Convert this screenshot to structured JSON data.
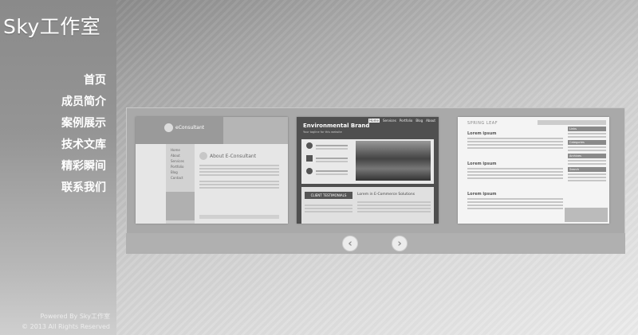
{
  "logo": "Sky工作室",
  "nav": [
    "首页",
    "成员简介",
    "案例展示",
    "技术文库",
    "精彩瞬间",
    "联系我们"
  ],
  "footer": {
    "line1": "Powered By Sky工作室",
    "line2": "© 2013 All Rights Reserved"
  },
  "slider": {
    "prev_icon": "chevron-left-icon",
    "next_icon": "chevron-right-icon",
    "prev_glyph": "‹",
    "next_glyph": "›",
    "thumbs": [
      {
        "logo_text": "eConsultant",
        "heading": "About E-Consultant",
        "menu": [
          "Home",
          "About",
          "Services",
          "Portfolio",
          "Blog",
          "Contact"
        ]
      },
      {
        "title": "Environmental Brand",
        "subtitle": "Your tagline for this website",
        "tabs": [
          "Home",
          "Services",
          "Portfolio",
          "Blog",
          "About"
        ],
        "section": "CLIENT TESTIMONIALS",
        "heading": "Lorem in E-Commerce Solutions"
      },
      {
        "title": "SPRING LEAF",
        "posts": [
          "Lorem ipsum",
          "Lorem ipsum",
          "Lorem ipsum"
        ],
        "side_tabs": [
          "Links",
          "Categories",
          "Archives",
          "Search"
        ]
      }
    ]
  }
}
